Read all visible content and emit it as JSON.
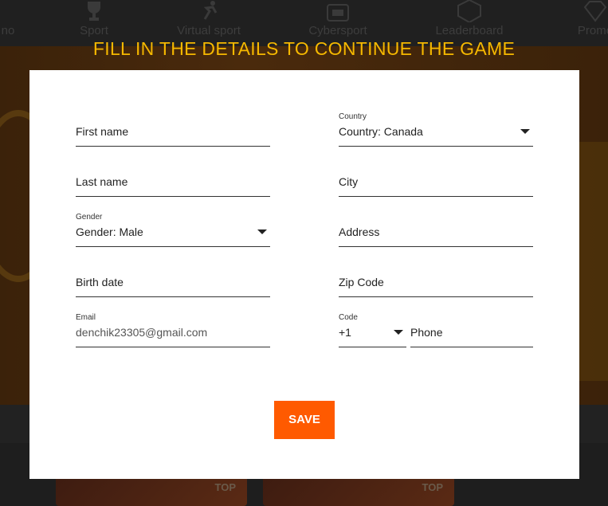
{
  "nav": {
    "items": [
      {
        "label": "no",
        "icon": "casino-icon"
      },
      {
        "label": "Sport",
        "icon": "trophy-icon"
      },
      {
        "label": "Virtual sport",
        "icon": "runner-icon"
      },
      {
        "label": "Cybersport",
        "icon": "arena-icon"
      },
      {
        "label": "Leaderboard",
        "icon": "shield-number-icon"
      },
      {
        "label": "Promo",
        "icon": "diamond-icon"
      }
    ]
  },
  "background": {
    "tiles": [
      {
        "tag": "TOP"
      },
      {
        "tag": "TOP"
      }
    ]
  },
  "modal": {
    "title": "FILL IN THE DETAILS TO CONTINUE THE GAME",
    "first_name": {
      "placeholder": "First name"
    },
    "last_name": {
      "placeholder": "Last name"
    },
    "gender": {
      "label": "Gender",
      "value": "Gender: Male"
    },
    "birth_date": {
      "placeholder": "Birth date"
    },
    "email": {
      "label": "Email",
      "value": "denchik23305@gmail.com"
    },
    "country": {
      "label": "Country",
      "value": "Country: Canada"
    },
    "city": {
      "placeholder": "City"
    },
    "address": {
      "placeholder": "Address"
    },
    "zip": {
      "placeholder": "Zip Code"
    },
    "code": {
      "label": "Code",
      "value": "+1"
    },
    "phone": {
      "placeholder": "Phone"
    },
    "save_label": "SAVE"
  },
  "colors": {
    "accent": "#ff5a00",
    "title": "#f5b800"
  }
}
